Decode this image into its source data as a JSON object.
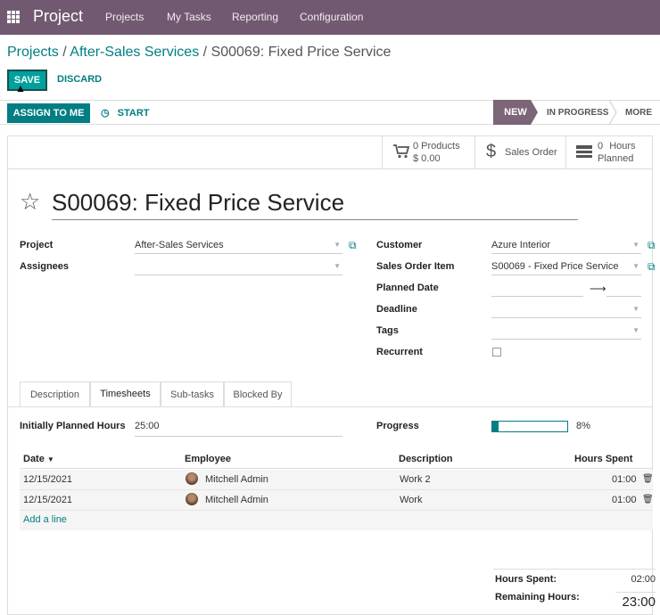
{
  "topbar": {
    "app_title": "Project",
    "menu": [
      "Projects",
      "My Tasks",
      "Reporting",
      "Configuration"
    ]
  },
  "breadcrumb": {
    "items": [
      "Projects",
      "After-Sales Services"
    ],
    "separator": "/",
    "current": "S00069: Fixed Price Service"
  },
  "actions": {
    "save": "SAVE",
    "discard": "DISCARD"
  },
  "statusbar": {
    "assign": "ASSIGN TO ME",
    "start": "START",
    "stages": [
      "NEW",
      "IN PROGRESS",
      "MORE"
    ],
    "active_stage": "NEW"
  },
  "smart_buttons": {
    "products_count": "0 Products",
    "products_amount": "$ 0.00",
    "sales_order": "Sales Order",
    "hours_value": "0",
    "hours_label": "Hours",
    "planned_label": "Planned"
  },
  "task": {
    "title": "S00069: Fixed Price Service"
  },
  "fields": {
    "project_label": "Project",
    "project_value": "After-Sales Services",
    "assignees_label": "Assignees",
    "assignees_value": "",
    "customer_label": "Customer",
    "customer_value": "Azure Interior",
    "so_item_label": "Sales Order Item",
    "so_item_value": "S00069 - Fixed Price Service",
    "planned_date_label": "Planned Date",
    "deadline_label": "Deadline",
    "tags_label": "Tags",
    "recurrent_label": "Recurrent",
    "recurrent_checked": false
  },
  "tabs": [
    "Description",
    "Timesheets",
    "Sub-tasks",
    "Blocked By"
  ],
  "active_tab": "Timesheets",
  "timesheets": {
    "planned_label": "Initially Planned Hours",
    "planned_value": "25:00",
    "progress_label": "Progress",
    "progress_percent": 8,
    "progress_text": "8%",
    "columns": [
      "Date",
      "Employee",
      "Description",
      "Hours Spent"
    ],
    "rows": [
      {
        "date": "12/15/2021",
        "employee": "Mitchell Admin",
        "description": "Work 2",
        "hours": "01:00"
      },
      {
        "date": "12/15/2021",
        "employee": "Mitchell Admin",
        "description": "Work",
        "hours": "01:00"
      }
    ],
    "add_line": "Add a line",
    "hours_spent_label": "Hours Spent:",
    "hours_spent_value": "02:00",
    "remaining_label": "Remaining Hours:",
    "remaining_value": "23:00"
  },
  "colors": {
    "topbar": "#715A71",
    "accent": "#017E84",
    "primary": "#00A09D"
  }
}
